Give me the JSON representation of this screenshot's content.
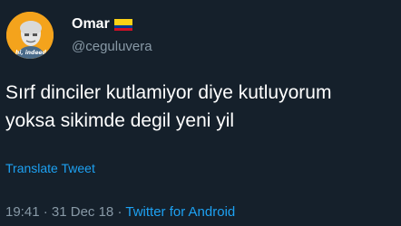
{
  "user": {
    "display_name": "Omar",
    "handle": "@ceguluvera",
    "avatar_caption": "hi, indeed",
    "flag_colors": [
      "#fcd116",
      "#003893",
      "#ce1126"
    ]
  },
  "tweet": {
    "text": "Sırf dinciler kutlamiyor diye kutluyorum\nyoksa sikimde degil yeni yil",
    "translate_label": "Translate Tweet",
    "time": "19:41",
    "separator": "·",
    "date": "31 Dec 18",
    "source": "Twitter for Android"
  },
  "colors": {
    "background": "#15202b",
    "link": "#1da1f2",
    "muted": "#8899a6",
    "avatar_bg": "#f4a31c"
  }
}
